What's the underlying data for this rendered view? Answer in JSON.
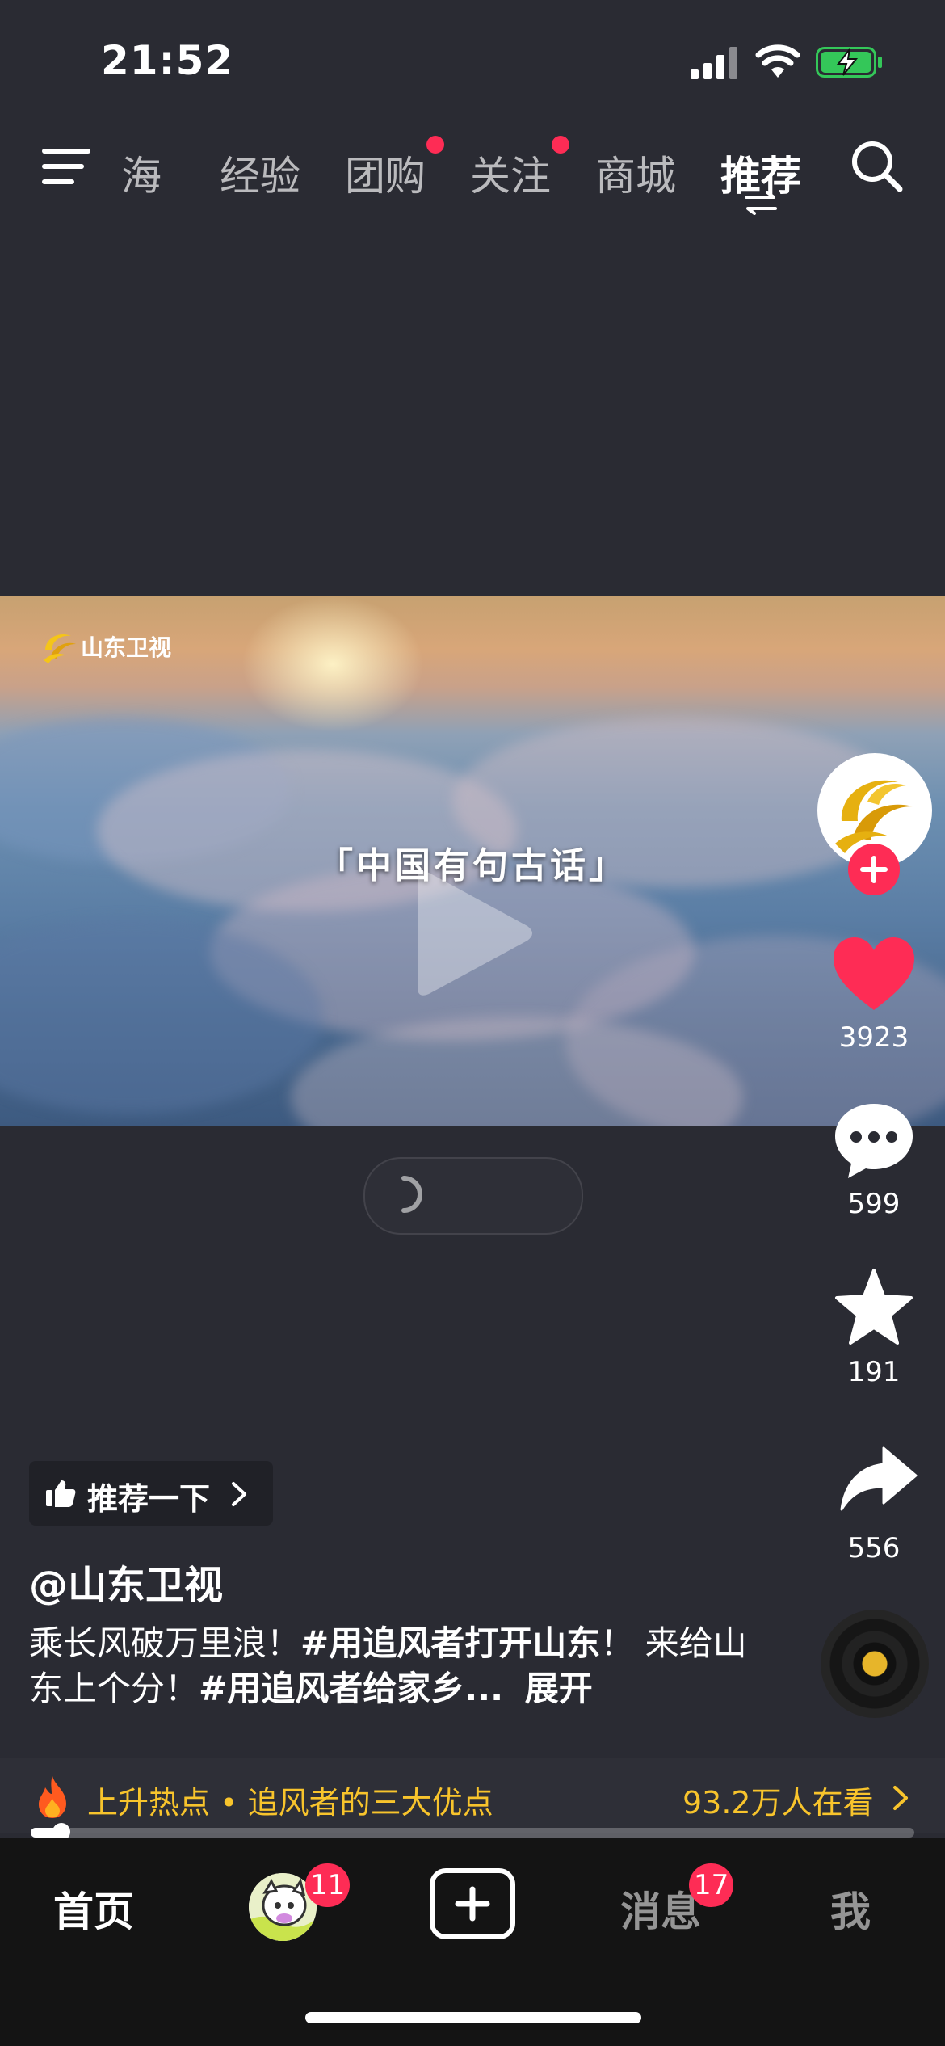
{
  "status_bar": {
    "time": "21:52"
  },
  "top_nav": {
    "tabs": [
      {
        "label": "海",
        "active": false
      },
      {
        "label": "经验",
        "active": false
      },
      {
        "label": "团购",
        "active": false,
        "dot": true
      },
      {
        "label": "关注",
        "active": false,
        "dot": true
      },
      {
        "label": "商城",
        "active": false
      },
      {
        "label": "推荐",
        "active": true
      }
    ]
  },
  "video": {
    "channel_logo_text": "山东卫视",
    "subtitle": "「中国有句古话」"
  },
  "right_rail": {
    "likes": "3923",
    "comments": "599",
    "favorites": "191",
    "shares": "556"
  },
  "caption": {
    "recommend_label": "推荐一下",
    "author": "@山东卫视",
    "desc_part1": "乘长风破万里浪！",
    "desc_tag1": "#用追风者打开山东",
    "desc_part2": "！ 来给山东上个分！",
    "desc_tag2": "#用追风者给家乡...",
    "expand": "展开"
  },
  "hot_bar": {
    "title": "上升热点 • 追风者的三大优点",
    "viewers": "93.2万人在看",
    "progress": 0.035
  },
  "bottom_nav": {
    "home": "首页",
    "friends_badge": "11",
    "messages": "消息",
    "messages_badge": "17",
    "me": "我"
  },
  "colors": {
    "accent": "#fe2c55",
    "hot": "#f8c42c",
    "background": "#2a2b33"
  }
}
